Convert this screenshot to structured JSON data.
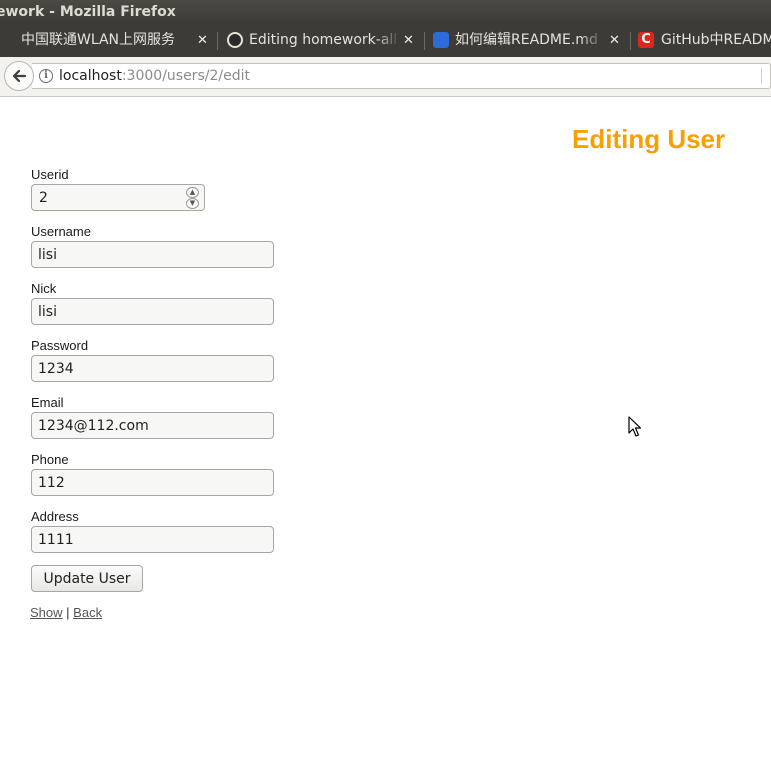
{
  "window": {
    "title": "ework - Mozilla Firefox"
  },
  "tabs": [
    {
      "label": "中国联通WLAN上网服务",
      "close": "✕"
    },
    {
      "label": "Editing homework-all",
      "close": "✕"
    },
    {
      "label": "如何编辑README.md",
      "close": "✕"
    },
    {
      "label": "GitHub中READM",
      "icon_text": "C"
    }
  ],
  "navbar": {
    "url_host": "localhost",
    "url_path": ":3000/users/2/edit",
    "back_glyph": "🡐",
    "info_glyph": "i"
  },
  "page": {
    "title": "Editing User",
    "title_color": "#f7a000"
  },
  "form": {
    "userid": {
      "label": "Userid",
      "value": "2"
    },
    "username": {
      "label": "Username",
      "value": "lisi"
    },
    "nick": {
      "label": "Nick",
      "value": "lisi"
    },
    "password": {
      "label": "Password",
      "value": "1234"
    },
    "email": {
      "label": "Email",
      "value": "1234@112.com"
    },
    "phone": {
      "label": "Phone",
      "value": "112"
    },
    "address": {
      "label": "Address",
      "value": "1111"
    },
    "submit_label": "Update User"
  },
  "links": {
    "show": "Show",
    "separator": "|",
    "back": "Back"
  }
}
